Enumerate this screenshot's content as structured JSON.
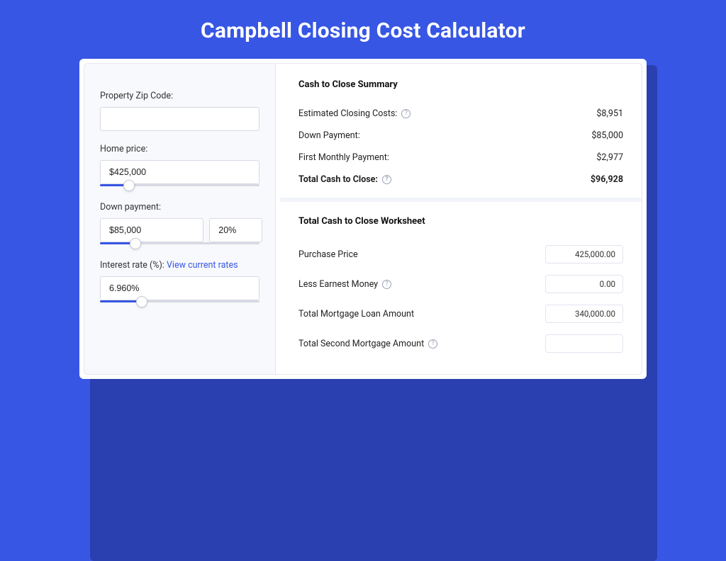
{
  "title": "Campbell Closing Cost Calculator",
  "left": {
    "zip_label": "Property Zip Code:",
    "zip_value": "",
    "home_price_label": "Home price:",
    "home_price_value": "$425,000",
    "home_price_slider_pct": 18,
    "down_label": "Down payment:",
    "down_value": "$85,000",
    "down_pct_value": "20%",
    "down_slider_pct": 22,
    "rate_label": "Interest rate (%):",
    "rate_link": "View current rates",
    "rate_value": "6.960%",
    "rate_slider_pct": 26
  },
  "summary": {
    "heading": "Cash to Close Summary",
    "rows": [
      {
        "label": "Estimated Closing Costs:",
        "help": true,
        "value": "$8,951",
        "bold": false
      },
      {
        "label": "Down Payment:",
        "help": false,
        "value": "$85,000",
        "bold": false
      },
      {
        "label": "First Monthly Payment:",
        "help": false,
        "value": "$2,977",
        "bold": false
      },
      {
        "label": "Total Cash to Close:",
        "help": true,
        "value": "$96,928",
        "bold": true
      }
    ]
  },
  "worksheet": {
    "heading": "Total Cash to Close Worksheet",
    "rows": [
      {
        "label": "Purchase Price",
        "help": false,
        "value": "425,000.00"
      },
      {
        "label": "Less Earnest Money",
        "help": true,
        "value": "0.00"
      },
      {
        "label": "Total Mortgage Loan Amount",
        "help": false,
        "value": "340,000.00"
      },
      {
        "label": "Total Second Mortgage Amount",
        "help": true,
        "value": ""
      }
    ]
  }
}
